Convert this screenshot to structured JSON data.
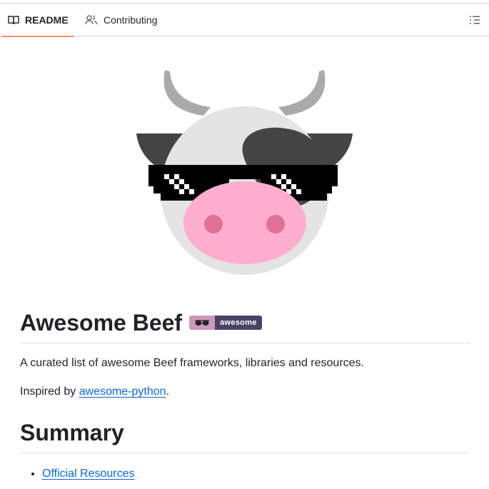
{
  "tabs": {
    "readme": "README",
    "contributing": "Contributing",
    "active": "readme"
  },
  "icons": {
    "readme": "book-icon",
    "contributing": "people-icon",
    "outline": "list-icon"
  },
  "logo": {
    "description_icon": "cow-with-pixel-sunglasses-logo"
  },
  "content": {
    "title": "Awesome Beef",
    "badge": {
      "label": "awesome",
      "icon": "sunglasses-icon",
      "colors": {
        "left": "#cc99bb",
        "right": "#494368"
      }
    },
    "description": "A curated list of awesome Beef frameworks, libraries and resources.",
    "inspired_prefix": "Inspired by ",
    "inspired_link": "awesome-python",
    "inspired_suffix": ".",
    "summary_heading": "Summary",
    "summary_items": [
      "Official Resources"
    ]
  },
  "colors": {
    "accent_underline": "#fd8c73",
    "link": "#0969da",
    "text": "#1f2328"
  }
}
